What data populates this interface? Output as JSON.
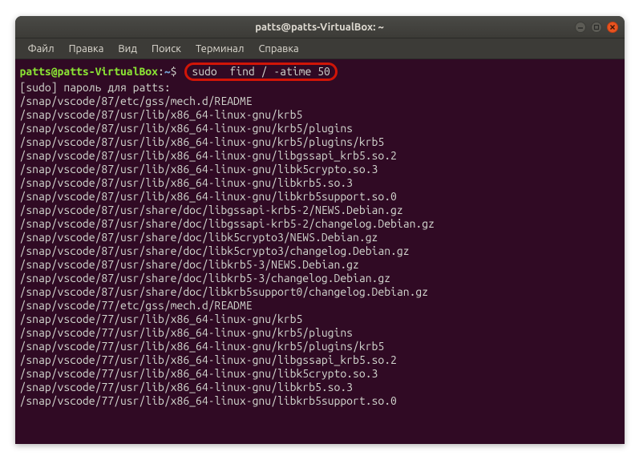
{
  "window": {
    "title": "patts@patts-VirtualBox: ~"
  },
  "menubar": {
    "items": [
      "Файл",
      "Правка",
      "Вид",
      "Поиск",
      "Терминал",
      "Справка"
    ]
  },
  "prompt": {
    "user_host": "patts@patts-VirtualBox",
    "colon": ":",
    "path": "~",
    "symbol": "$"
  },
  "command": "sudo  find / -atime 50",
  "output": [
    "[sudo] пароль для patts:",
    "/snap/vscode/87/etc/gss/mech.d/README",
    "/snap/vscode/87/usr/lib/x86_64-linux-gnu/krb5",
    "/snap/vscode/87/usr/lib/x86_64-linux-gnu/krb5/plugins",
    "/snap/vscode/87/usr/lib/x86_64-linux-gnu/krb5/plugins/krb5",
    "/snap/vscode/87/usr/lib/x86_64-linux-gnu/libgssapi_krb5.so.2",
    "/snap/vscode/87/usr/lib/x86_64-linux-gnu/libk5crypto.so.3",
    "/snap/vscode/87/usr/lib/x86_64-linux-gnu/libkrb5.so.3",
    "/snap/vscode/87/usr/lib/x86_64-linux-gnu/libkrb5support.so.0",
    "/snap/vscode/87/usr/share/doc/libgssapi-krb5-2/NEWS.Debian.gz",
    "/snap/vscode/87/usr/share/doc/libgssapi-krb5-2/changelog.Debian.gz",
    "/snap/vscode/87/usr/share/doc/libk5crypto3/NEWS.Debian.gz",
    "/snap/vscode/87/usr/share/doc/libk5crypto3/changelog.Debian.gz",
    "/snap/vscode/87/usr/share/doc/libkrb5-3/NEWS.Debian.gz",
    "/snap/vscode/87/usr/share/doc/libkrb5-3/changelog.Debian.gz",
    "/snap/vscode/87/usr/share/doc/libkrb5support0/changelog.Debian.gz",
    "/snap/vscode/77/etc/gss/mech.d/README",
    "/snap/vscode/77/usr/lib/x86_64-linux-gnu/krb5",
    "/snap/vscode/77/usr/lib/x86_64-linux-gnu/krb5/plugins",
    "/snap/vscode/77/usr/lib/x86_64-linux-gnu/krb5/plugins/krb5",
    "/snap/vscode/77/usr/lib/x86_64-linux-gnu/libgssapi_krb5.so.2",
    "/snap/vscode/77/usr/lib/x86_64-linux-gnu/libk5crypto.so.3",
    "/snap/vscode/77/usr/lib/x86_64-linux-gnu/libkrb5.so.3",
    "/snap/vscode/77/usr/lib/x86_64-linux-gnu/libkrb5support.so.0"
  ]
}
